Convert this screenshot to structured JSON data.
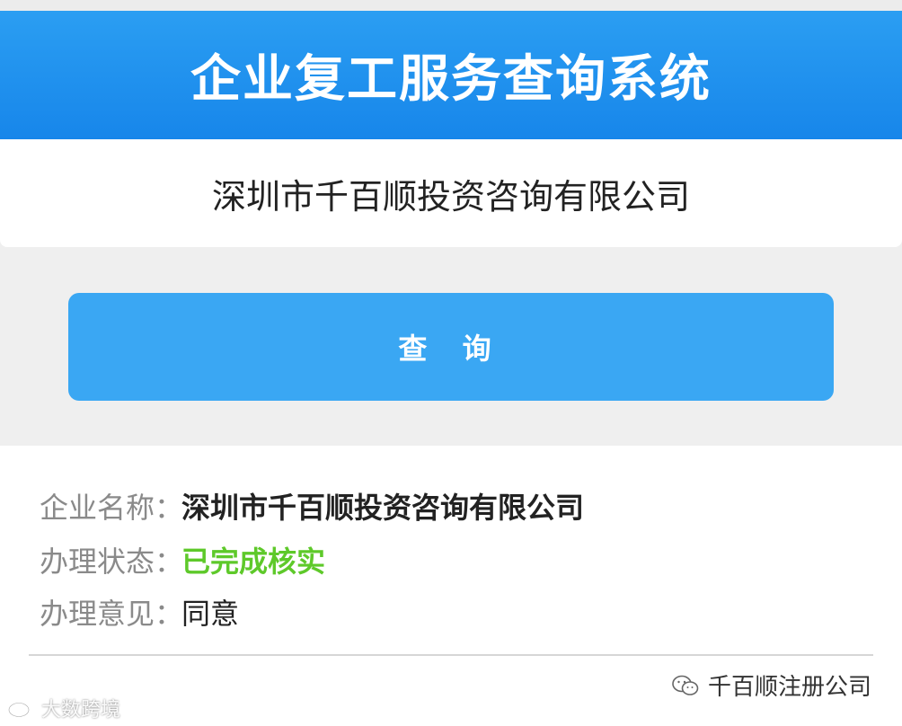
{
  "header": {
    "title": "企业复工服务查询系统"
  },
  "search": {
    "company_value": "深圳市千百顺投资咨询有限公司"
  },
  "actions": {
    "query_label": "查 询"
  },
  "result": {
    "rows": [
      {
        "label": "企业名称：",
        "value": "深圳市千百顺投资咨询有限公司"
      },
      {
        "label": "办理状态：",
        "value": "已完成核实"
      },
      {
        "label": "办理意见：",
        "value": "同意"
      }
    ]
  },
  "footer": {
    "brand": "千百顺注册公司"
  },
  "watermark": {
    "text": "大数跨境"
  },
  "colors": {
    "header_blue": "#1786ea",
    "button_blue": "#3aa7f3",
    "status_green": "#5ec92a"
  },
  "icons": {
    "footer": "wechat-icon",
    "watermark": "weibo-logo"
  }
}
